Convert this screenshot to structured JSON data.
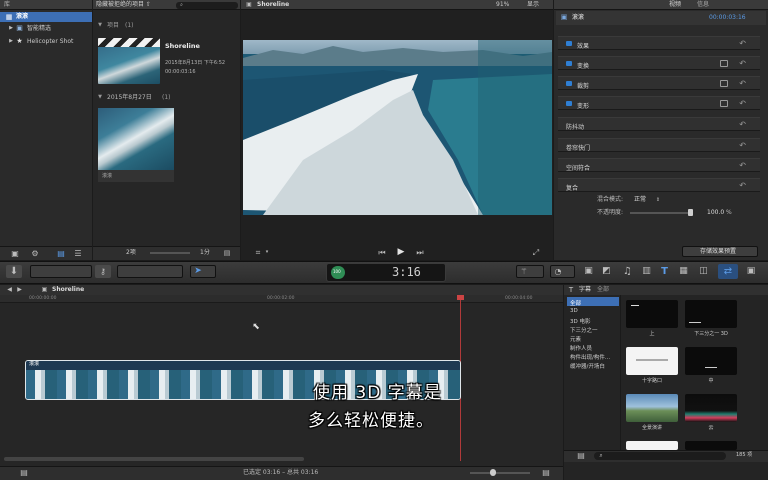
{
  "library": {
    "header_label": "库",
    "items": [
      {
        "label": "滚滚"
      },
      {
        "label": "智能精选"
      },
      {
        "label": "Helicopter Shot"
      }
    ]
  },
  "browser": {
    "header_label": "隐藏被拒绝的项目 ⇧",
    "section1": {
      "label": "项目",
      "count": "(1)"
    },
    "project": {
      "name": "Shoreline",
      "date": "2015年8月13日 下午6:52",
      "duration": "00:00:03:16"
    },
    "section2": {
      "label": "2015年8月27日",
      "count": "(1)"
    },
    "clip_label": "滚滚",
    "footer_count": "2项",
    "footer_dur": "1分"
  },
  "viewer": {
    "title": "Shoreline",
    "zoom": "91%",
    "zoom_menu": "显示"
  },
  "inspector": {
    "tab_video": "视频",
    "tab_info": "信息",
    "clip_name": "滚滚",
    "clip_time": "00:00:03:16",
    "rows": [
      {
        "label": "效果",
        "bullet": true
      },
      {
        "label": "变换",
        "bullet": true,
        "kf": true
      },
      {
        "label": "裁剪",
        "bullet": true,
        "kf": true
      },
      {
        "label": "变形",
        "bullet": true,
        "kf": true
      },
      {
        "label": "防抖动",
        "bullet": false
      },
      {
        "label": "卷帘快门",
        "bullet": false
      },
      {
        "label": "空间符合",
        "bullet": false
      },
      {
        "label": "复合",
        "bullet": false
      }
    ],
    "blend_mode_label": "混合模式:",
    "blend_mode_value": "正常",
    "opacity_label": "不透明度:",
    "opacity_value": "100.0",
    "opacity_unit": "%",
    "save_button": "存储效果预置"
  },
  "toolbar": {
    "timecode": "3:16",
    "timecode_prefix": "100"
  },
  "timeline": {
    "project_title": "Shoreline",
    "ruler_left": "00:00:00:00",
    "ruler_mid": "00:00:02:00",
    "ruler_right": "00:00:04:00",
    "clip_label": "滚滚",
    "status": "已选定 03:16 – 总共 03:16"
  },
  "subtitle": {
    "line1": "使用 3D 字幕是",
    "line2": "多么轻松便捷。"
  },
  "effects_browser": {
    "header_label": "字幕",
    "header_sub": "全部",
    "categories": [
      {
        "label": "全部"
      },
      {
        "label": "3D"
      },
      {
        "label": "3D 电影"
      },
      {
        "label": "下三分之一"
      },
      {
        "label": "元素"
      },
      {
        "label": "制作人员"
      },
      {
        "label": "构件出现/构件..."
      },
      {
        "label": "缓冲器/开场白"
      }
    ],
    "tiles": [
      {
        "caption": "上"
      },
      {
        "caption": "下三分之一 3D"
      },
      {
        "caption": "十字路口"
      },
      {
        "caption": "中"
      },
      {
        "caption": "全景演讲"
      },
      {
        "caption": "云"
      }
    ],
    "count": "185 项"
  },
  "colors": {
    "accent": "#2f7fd4",
    "selection": "#3d6fb5",
    "panel": "#262626",
    "header": "#3a3a3a"
  }
}
